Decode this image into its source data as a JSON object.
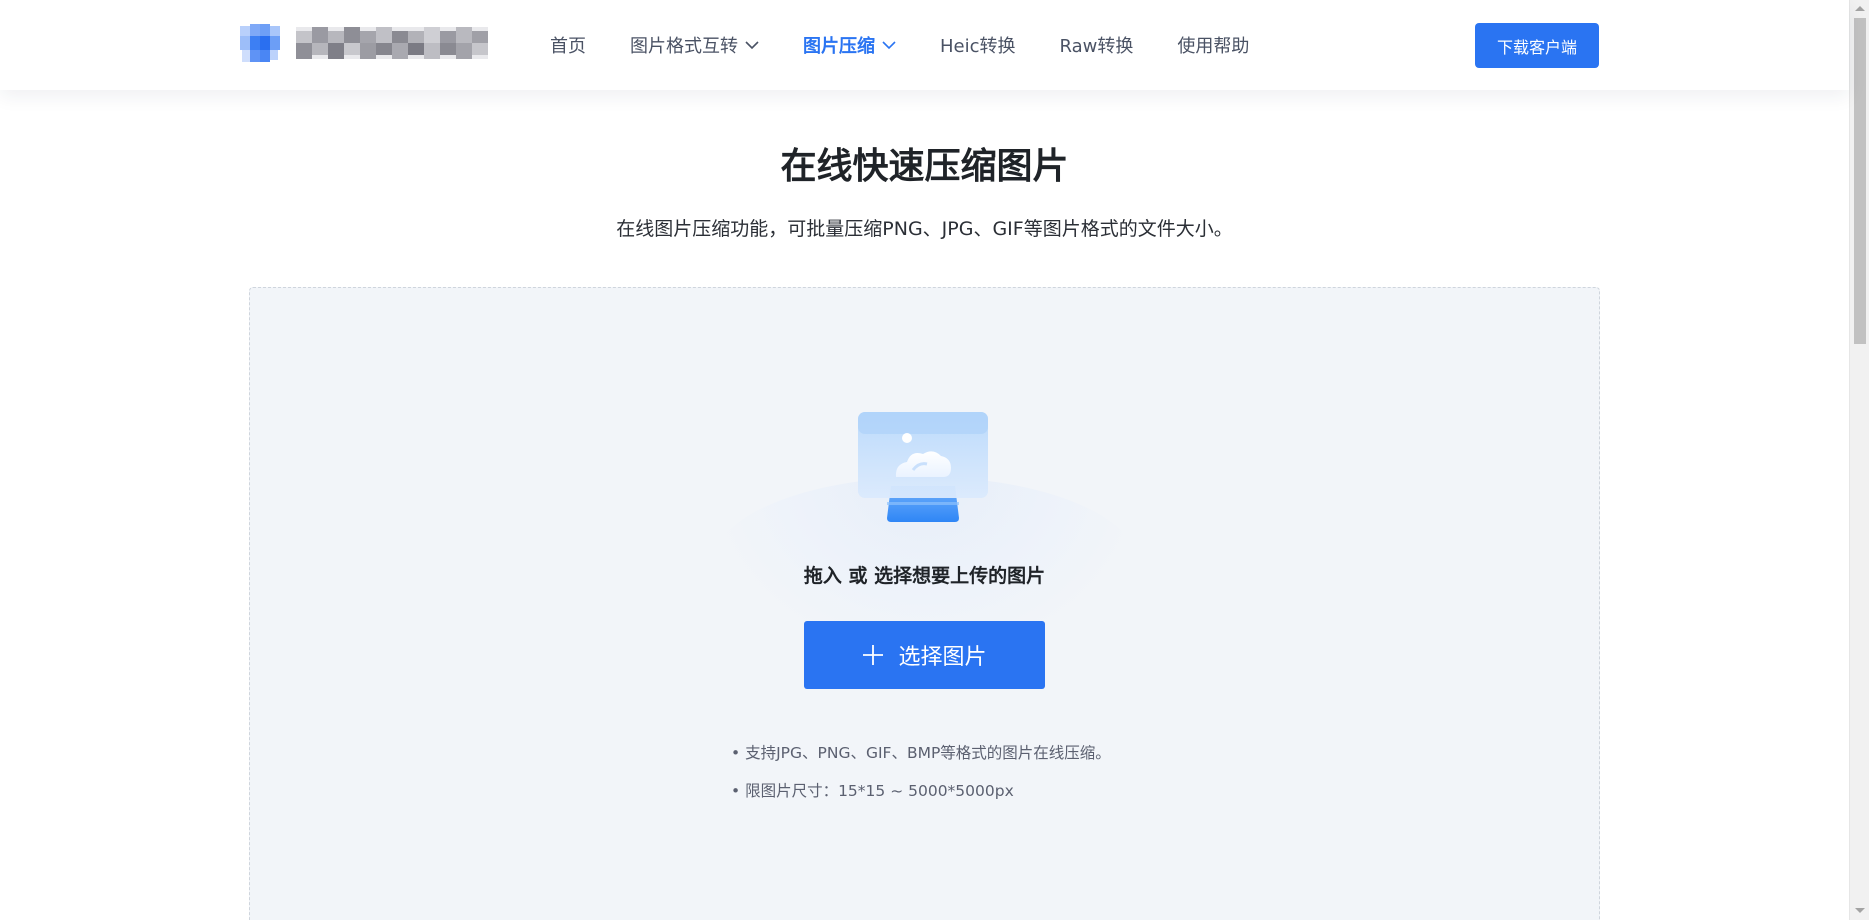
{
  "header": {
    "nav": [
      {
        "label": "首页",
        "has_dropdown": false,
        "active": false
      },
      {
        "label": "图片格式互转",
        "has_dropdown": true,
        "active": false
      },
      {
        "label": "图片压缩",
        "has_dropdown": true,
        "active": true
      },
      {
        "label": "Heic转换",
        "has_dropdown": false,
        "active": false
      },
      {
        "label": "Raw转换",
        "has_dropdown": false,
        "active": false
      },
      {
        "label": "使用帮助",
        "has_dropdown": false,
        "active": false
      }
    ],
    "download_label": "下载客户端"
  },
  "main": {
    "title": "在线快速压缩图片",
    "subtitle": "在线图片压缩功能，可批量压缩PNG、JPG、GIF等图片格式的文件大小。"
  },
  "upload": {
    "prompt": "拖入 或 选择想要上传的图片",
    "button_label": "选择图片",
    "notes": [
      "• 支持JPG、PNG、GIF、BMP等格式的图片在线压缩。",
      "• 限图片尺寸：15*15 ~ 5000*5000px"
    ]
  },
  "icons": {
    "logo": "app-logo-icon",
    "dropdown": "chevron-down-icon",
    "plus": "plus-icon",
    "upload": "image-upload-icon"
  },
  "colors": {
    "accent": "#2a74f2",
    "upload_bg": "#f2f5f9",
    "text_primary": "#1f2328",
    "text_muted": "#5b6070"
  }
}
